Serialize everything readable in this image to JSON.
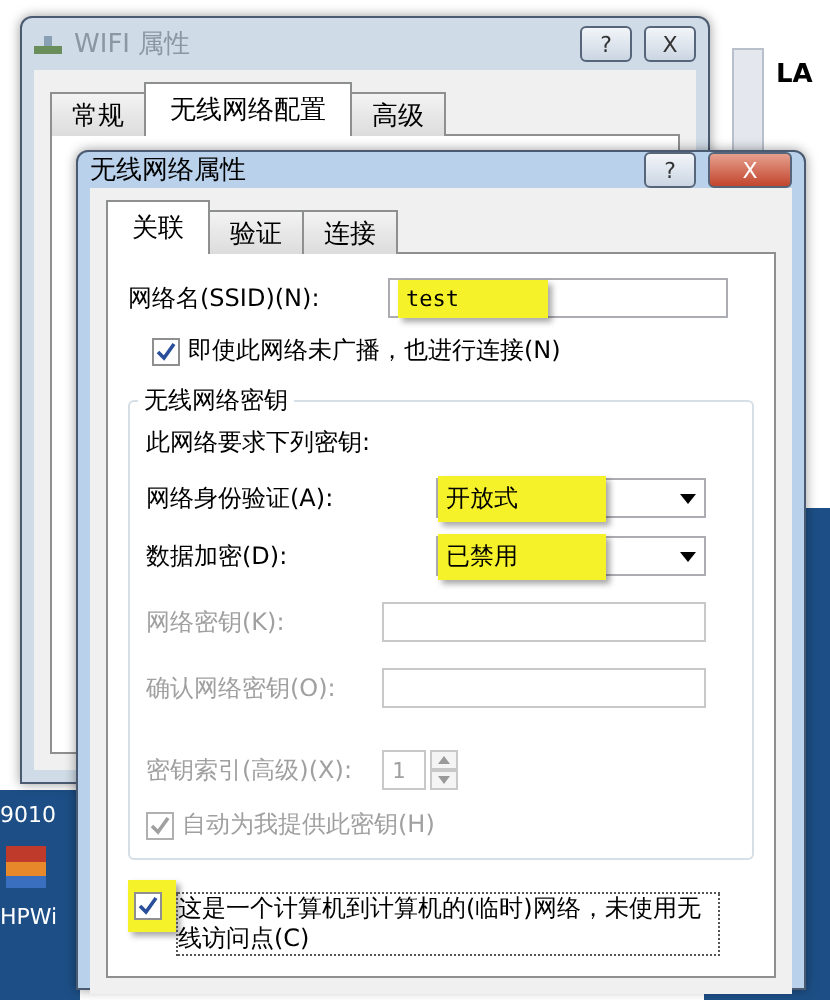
{
  "desktop": {
    "icons": [
      {
        "label": "9010"
      },
      {
        "label": "HPWi"
      }
    ],
    "side_window": {
      "text": "LA"
    }
  },
  "back_window": {
    "title": "WIFI 属性",
    "tabs": [
      {
        "label": "常规",
        "selected": false
      },
      {
        "label": "无线网络配置",
        "selected": true
      },
      {
        "label": "高级",
        "selected": false
      }
    ],
    "help": "?",
    "close": "X"
  },
  "dialog": {
    "title": "无线网络属性",
    "help": "?",
    "close": "X",
    "tabs": [
      {
        "label": "关联",
        "selected": true
      },
      {
        "label": "验证",
        "selected": false
      },
      {
        "label": "连接",
        "selected": false
      }
    ],
    "ssid": {
      "label": "网络名(SSID)(N):",
      "value": "test",
      "highlighted": true
    },
    "broadcast_checkbox": {
      "label": "即使此网络未广播，也进行连接(N)",
      "checked": true,
      "disabled": false
    },
    "key_group": {
      "title": "无线网络密钥",
      "note": "此网络要求下列密钥:",
      "rows": [
        {
          "kind": "select",
          "label": "网络身份验证(A):",
          "value": "开放式",
          "highlighted": true,
          "disabled": false
        },
        {
          "kind": "select",
          "label": "数据加密(D):",
          "value": "已禁用",
          "highlighted": true,
          "disabled": false
        },
        {
          "kind": "input",
          "label": "网络密钥(K):",
          "disabled": true
        },
        {
          "kind": "input",
          "label": "确认网络密钥(O):",
          "disabled": true
        },
        {
          "kind": "spinner",
          "label": "密钥索引(高级)(X):",
          "value": "1",
          "disabled": true
        },
        {
          "kind": "checkbox",
          "label": "自动为我提供此密钥(H)",
          "checked": true,
          "disabled": true
        }
      ]
    },
    "adhoc_checkbox": {
      "label": "这是一个计算机到计算机的(临时)网络，未使用无线访问点(C)",
      "checked": true,
      "highlighted": true,
      "disabled": false
    }
  }
}
